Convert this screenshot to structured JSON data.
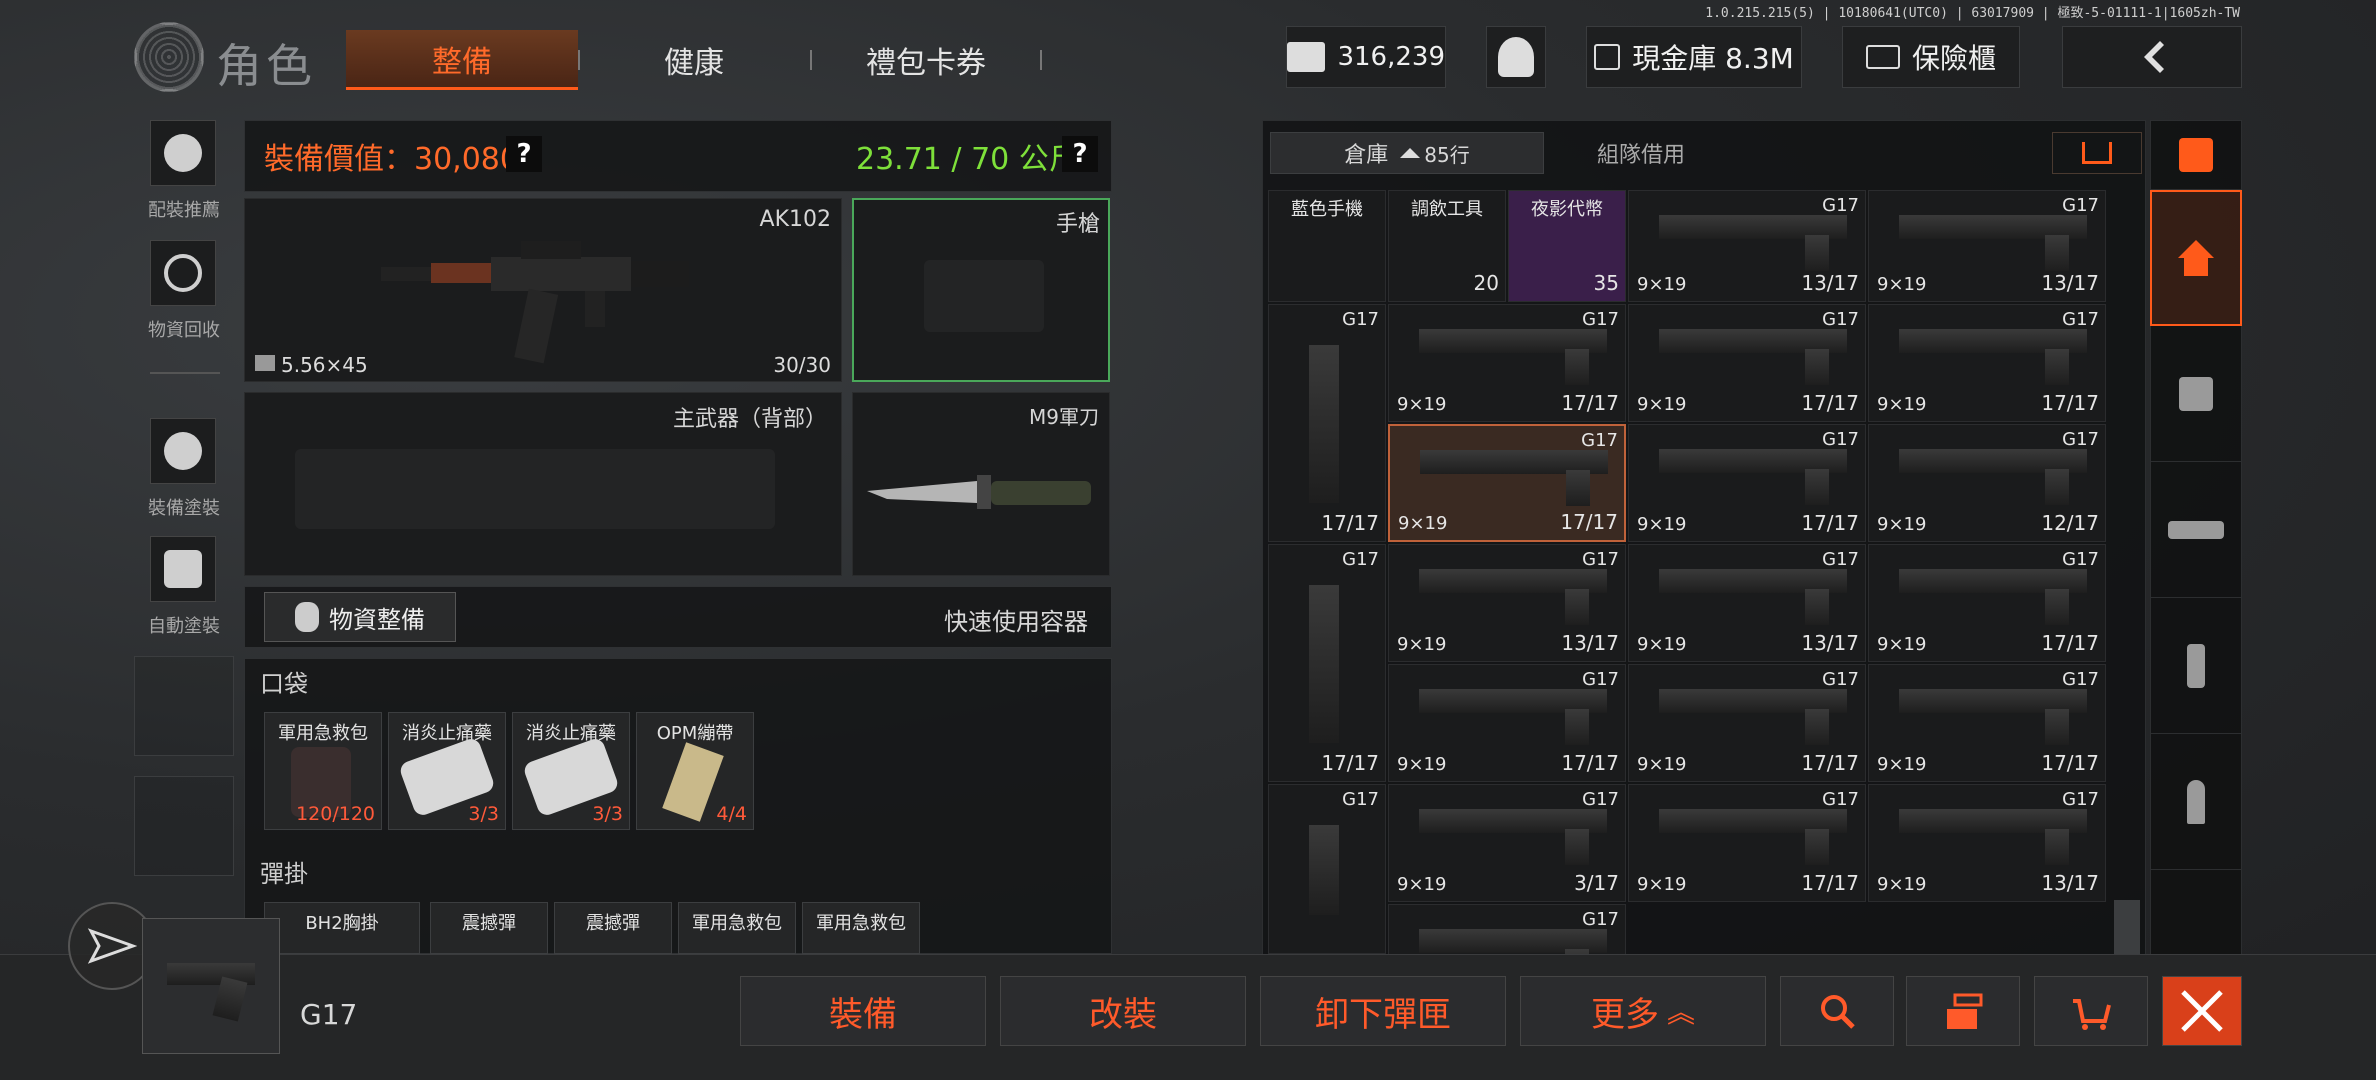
{
  "version": "1.0.215.215(5) | 10180641(UTC0) | 63017909 | 極致-5-01111-1|1605zh-TW",
  "header": {
    "title": "角色",
    "tabs": [
      "整備",
      "健康",
      "禮包卡券"
    ],
    "currency": "316,239",
    "cash_vault": "現金庫 8.3M",
    "safe_box": "保險櫃"
  },
  "sidebar": [
    {
      "label": "配裝推薦",
      "icon": "helmet-icon"
    },
    {
      "label": "物資回收",
      "icon": "recycle-icon"
    },
    {
      "label": "裝備塗裝",
      "icon": "paint-helmet-icon"
    },
    {
      "label": "自動塗裝",
      "icon": "auto-paint-icon"
    }
  ],
  "equipment": {
    "value_label": "裝備價值：30,080",
    "weight_label": "23.71 / 70 公斤",
    "help": "?",
    "primary_name": "AK102",
    "primary_ammo": "5.56×45",
    "primary_count": "30/30",
    "pistol_slot": "手槍",
    "secondary_slot": "主武器（背部）",
    "melee_name": "M9軍刀",
    "supply_button": "物資整備",
    "quick_container": "快速使用容器",
    "pockets_title": "口袋",
    "pockets": [
      {
        "name": "軍用急救包",
        "count": "120/120"
      },
      {
        "name": "消炎止痛藥",
        "count": "3/3"
      },
      {
        "name": "消炎止痛藥",
        "count": "3/3"
      },
      {
        "name": "OPM繃帶",
        "count": "4/4"
      }
    ],
    "rig_title": "彈掛",
    "rig_items": [
      "BH2胸掛",
      "震撼彈",
      "震撼彈",
      "軍用急救包",
      "軍用急救包"
    ]
  },
  "storage": {
    "tabs": [
      "倉庫",
      "85行",
      "組隊借用"
    ],
    "top_items": [
      {
        "name": "藍色手機"
      },
      {
        "name": "調飲工具",
        "count": "20"
      },
      {
        "name": "夜影代幣",
        "count": "35"
      }
    ],
    "gun": "G17",
    "ammo": "9×19",
    "rows": [
      [
        null,
        null,
        null,
        {
          "count": "13/17"
        },
        {
          "count": "13/17"
        }
      ],
      [
        {
          "count": "17/17"
        },
        {
          "count": "17/17"
        },
        {
          "count": "17/17"
        },
        {
          "count": "17/17"
        }
      ],
      [
        {
          "count": "17/17"
        },
        {
          "count": "17/17"
        },
        {
          "count": "17/17"
        },
        {
          "count": "12/17"
        }
      ],
      [
        {
          "count": "17/17"
        },
        {
          "count": "13/17"
        },
        {
          "count": "13/17"
        },
        {
          "count": "17/17"
        }
      ],
      [
        null,
        {
          "count": "17/17"
        },
        {
          "count": "17/17"
        },
        {
          "count": "17/17"
        }
      ],
      [
        {
          "count": "?"
        },
        {
          "count": "3/17"
        },
        {
          "count": "17/17"
        },
        {
          "count": "13/17"
        }
      ]
    ]
  },
  "bottom": {
    "selected_item": "G17",
    "actions": [
      "裝備",
      "改裝",
      "卸下彈匣",
      "更多"
    ]
  },
  "colors": {
    "accent": "#ff5a1a",
    "weight": "#7ee03a"
  }
}
